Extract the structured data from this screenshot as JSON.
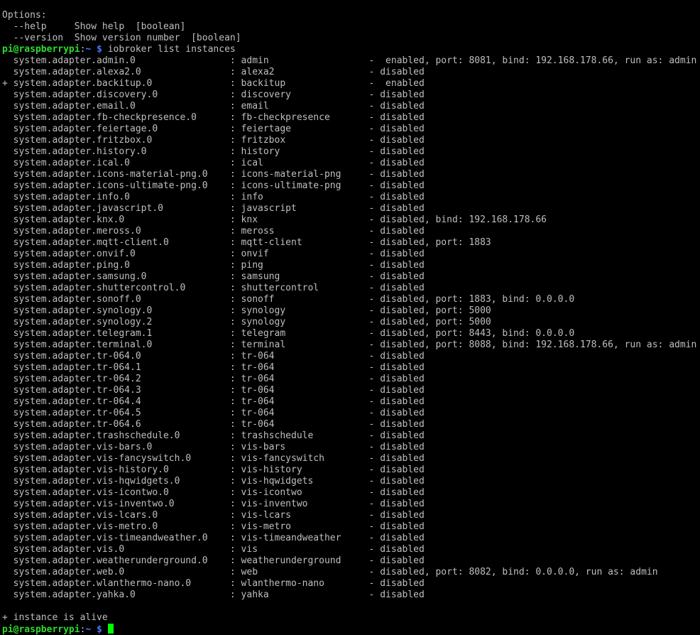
{
  "colors": {
    "background": "#000000",
    "text": "#bfbfbf",
    "prompt_user": "#2ddc2d",
    "prompt_path": "#4a78ff",
    "cursor": "#00ff00"
  },
  "help": {
    "heading": "Options:",
    "options": [
      "  --help     Show help  [boolean]",
      "  --version  Show version number  [boolean]"
    ]
  },
  "prompt": {
    "user_host": "pi@raspberrypi",
    "separator": ":",
    "path": "~ $",
    "command": " iobroker list instances"
  },
  "instances": [
    "  system.adapter.admin.0                 : admin                  -  enabled, port: 8081, bind: 192.168.178.66, run as: admin",
    "  system.adapter.alexa2.0                : alexa2                 - disabled",
    "+ system.adapter.backitup.0              : backitup               -  enabled",
    "  system.adapter.discovery.0             : discovery              - disabled",
    "  system.adapter.email.0                 : email                  - disabled",
    "  system.adapter.fb-checkpresence.0      : fb-checkpresence       - disabled",
    "  system.adapter.feiertage.0             : feiertage              - disabled",
    "  system.adapter.fritzbox.0              : fritzbox               - disabled",
    "  system.adapter.history.0               : history                - disabled",
    "  system.adapter.ical.0                  : ical                   - disabled",
    "  system.adapter.icons-material-png.0    : icons-material-png     - disabled",
    "  system.adapter.icons-ultimate-png.0    : icons-ultimate-png     - disabled",
    "  system.adapter.info.0                  : info                   - disabled",
    "  system.adapter.javascript.0            : javascript             - disabled",
    "  system.adapter.knx.0                   : knx                    - disabled, bind: 192.168.178.66",
    "  system.adapter.meross.0                : meross                 - disabled",
    "  system.adapter.mqtt-client.0           : mqtt-client            - disabled, port: 1883",
    "  system.adapter.onvif.0                 : onvif                  - disabled",
    "  system.adapter.ping.0                  : ping                   - disabled",
    "  system.adapter.samsung.0               : samsung                - disabled",
    "  system.adapter.shuttercontrol.0        : shuttercontrol         - disabled",
    "  system.adapter.sonoff.0                : sonoff                 - disabled, port: 1883, bind: 0.0.0.0",
    "  system.adapter.synology.0              : synology               - disabled, port: 5000",
    "  system.adapter.synology.2              : synology               - disabled, port: 5000",
    "  system.adapter.telegram.1              : telegram               - disabled, port: 8443, bind: 0.0.0.0",
    "  system.adapter.terminal.0              : terminal               - disabled, port: 8088, bind: 192.168.178.66, run as: admin",
    "  system.adapter.tr-064.0                : tr-064                 - disabled",
    "  system.adapter.tr-064.1                : tr-064                 - disabled",
    "  system.adapter.tr-064.2                : tr-064                 - disabled",
    "  system.adapter.tr-064.3                : tr-064                 - disabled",
    "  system.adapter.tr-064.4                : tr-064                 - disabled",
    "  system.adapter.tr-064.5                : tr-064                 - disabled",
    "  system.adapter.tr-064.6                : tr-064                 - disabled",
    "  system.adapter.trashschedule.0         : trashschedule          - disabled",
    "  system.adapter.vis-bars.0              : vis-bars               - disabled",
    "  system.adapter.vis-fancyswitch.0       : vis-fancyswitch        - disabled",
    "  system.adapter.vis-history.0           : vis-history            - disabled",
    "  system.adapter.vis-hqwidgets.0         : vis-hqwidgets          - disabled",
    "  system.adapter.vis-icontwo.0           : vis-icontwo            - disabled",
    "  system.adapter.vis-inventwo.0          : vis-inventwo           - disabled",
    "  system.adapter.vis-lcars.0             : vis-lcars              - disabled",
    "  system.adapter.vis-metro.0             : vis-metro              - disabled",
    "  system.adapter.vis-timeandweather.0    : vis-timeandweather     - disabled",
    "  system.adapter.vis.0                   : vis                    - disabled",
    "  system.adapter.weatherunderground.0    : weatherunderground     - disabled",
    "  system.adapter.web.0                   : web                    - disabled, port: 8082, bind: 0.0.0.0, run as: admin",
    "  system.adapter.wlanthermo-nano.0       : wlanthermo-nano        - disabled",
    "  system.adapter.yahka.0                 : yahka                  - disabled"
  ],
  "legend": "+ instance is alive"
}
